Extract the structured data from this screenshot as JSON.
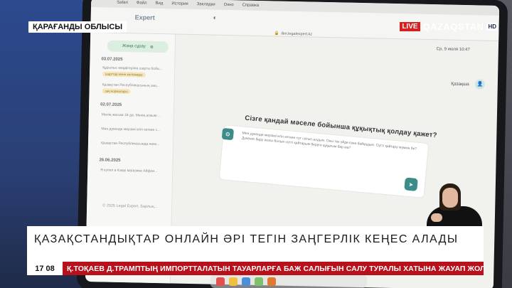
{
  "broadcast": {
    "region": "ҚАРАҒАНДЫ ОБЛЫСЫ",
    "live": "LIVE",
    "channel": "QAZAQSTAN",
    "hd": "HD",
    "headline": "ҚАЗАҚСТАНДЫҚТАР ОНЛАЙН ӘРІ ТЕГІН ЗАҢГЕРЛІК КЕҢЕС АЛАДЫ",
    "time_h": "17",
    "time_m": "08",
    "ticker": "Қ.ТОҚАЕВ Д.ТРАМПТЫҢ ИМПОРТТАЛАТЫН ТАУАРЛАРҒА БАЖ САЛЫҒЫН САЛУ ТУРАЛЫ ХАТЫНА ЖАУАП ЖОЛДАДЫ"
  },
  "menubar": {
    "apple": "",
    "items": [
      "Safari",
      "Файл",
      "Вид",
      "История",
      "Закладки",
      "Окно",
      "Справка"
    ],
    "right": "Ср, 9 июля 10:47"
  },
  "app": {
    "brand": "Expert",
    "url": "ilim.legalexpert.kz",
    "new_chat": "Жаңа сұрау",
    "groups": [
      {
        "date": "03.07.2025",
        "items": [
          {
            "text": "Құрылыс мердігерінің шарты бойы...",
            "tag": "шарттар және келісімдер"
          },
          {
            "text": "Қазақстан Республикасының заң...",
            "tag": "заң нормалары"
          }
        ]
      },
      {
        "date": "02.07.2025",
        "items": [
          {
            "text": "Менің жасым 16-да. Менің атаым ...",
            "tag": ""
          },
          {
            "text": "Мен дүкенде мерзімі өтіп кеткен с...",
            "tag": ""
          },
          {
            "text": "Қазақстан Республикасында неке...",
            "tag": ""
          }
        ]
      },
      {
        "date": "26.06.2025",
        "items": [
          {
            "text": "Я купил в Kaspi магазине Айфон...",
            "tag": ""
          }
        ]
      }
    ],
    "footer": "© 2025 Legal Expert. Барлық...",
    "user_name": "Қазақша",
    "question": "Сізге қандай мәселе бойынша құқықтық қолдау қажет?",
    "message": "Мен дүкенде мерзімі өтіп кеткен сүт сатып алдым. Оны тек үйде ғана байқадым. Сүтті қайтару мүмкін бе? Дүкенге бару жолы болып сүтті қайтарым беруге құқығым бар ма?"
  }
}
